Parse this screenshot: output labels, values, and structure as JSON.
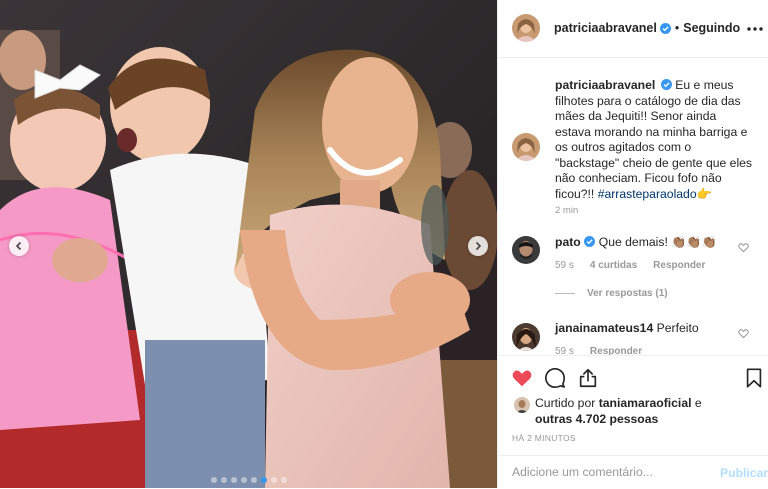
{
  "photo": {
    "carousel_total": 8,
    "carousel_active": 6,
    "prev_icon": "chevron-left-icon",
    "next_icon": "chevron-right-icon"
  },
  "header": {
    "username": "patriciaabravanel",
    "separator": "•",
    "follow_status": "Seguindo",
    "more_icon": "more-horizontal-icon",
    "verified_icon": "verified-badge-icon"
  },
  "caption": {
    "username": "patriciaabravanel",
    "text_before_hashtag": "Eu e meus filhotes para o catálogo de dia das mães da Jequiti!! Senor ainda estava morando na minha barriga e os outros agitados com o \"backstage\" cheio de gente que eles não conheciam. Ficou fofo não ficou?!!",
    "hashtag": "#arrasteparaolado",
    "emoji": "👉",
    "time": "2 min"
  },
  "comments": [
    {
      "username": "pato",
      "text": "Que demais! 👏🏽👏🏽👏🏽",
      "time": "59 s",
      "likes": "4 curtidas",
      "reply": "Responder"
    },
    {
      "username": "janainamateus14",
      "text": "Perfeito",
      "time": "59 s",
      "reply": "Responder"
    }
  ],
  "view_replies": "Ver respostas (1)",
  "likes": {
    "prefix": "Curtido por",
    "user": "taniamaraoficial",
    "connector": "e",
    "others": "outras 4.702 pessoas"
  },
  "post_time": "HÁ 2 MINUTOS",
  "comment_box": {
    "placeholder": "Adicione um comentário...",
    "publish_label": "Publicar"
  },
  "colors": {
    "like_red": "#ed4956",
    "link_blue": "#003569",
    "verified_blue": "#3897f0",
    "publish_disabled": "#b2dffc"
  }
}
